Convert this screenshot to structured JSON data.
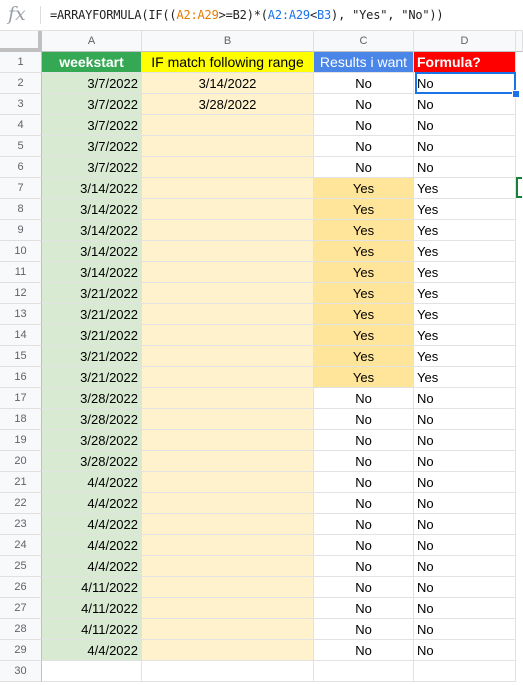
{
  "formula_bar": {
    "icon": "fx-icon",
    "parts": [
      {
        "text": "=ARRAYFORMULA(IF((",
        "color": ""
      },
      {
        "text": "A2:A29",
        "color": "#e67c00"
      },
      {
        "text": ">=B2)*(",
        "color": ""
      },
      {
        "text": "A2:A29",
        "color": "#1a73e8"
      },
      {
        "text": "<",
        "color": ""
      },
      {
        "text": "B3",
        "color": "#1a73e8"
      },
      {
        "text": "), \"Yes\", \"No\"))",
        "color": ""
      }
    ]
  },
  "columns": [
    "A",
    "B",
    "C",
    "D"
  ],
  "headers": {
    "A": "weekstart",
    "B": "IF match following range",
    "C": "Results i want",
    "D": "Formula?"
  },
  "colors": {
    "header_A_bg": "#34a853",
    "header_B_bg": "#ffff00",
    "header_C_bg": "#4a86e8",
    "header_D_bg": "#ff0000",
    "col_A_bg": "#d9ead3",
    "col_B_bg": "#fff2cc",
    "col_C_highlight_bg": "#ffe599",
    "selection": "#1a73e8"
  },
  "rows": [
    {
      "num": "2",
      "a": "3/7/2022",
      "b": "3/14/2022",
      "c": "No",
      "d": "No"
    },
    {
      "num": "3",
      "a": "3/7/2022",
      "b": "3/28/2022",
      "c": "No",
      "d": "No"
    },
    {
      "num": "4",
      "a": "3/7/2022",
      "b": "",
      "c": "No",
      "d": "No"
    },
    {
      "num": "5",
      "a": "3/7/2022",
      "b": "",
      "c": "No",
      "d": "No"
    },
    {
      "num": "6",
      "a": "3/7/2022",
      "b": "",
      "c": "No",
      "d": "No"
    },
    {
      "num": "7",
      "a": "3/14/2022",
      "b": "",
      "c": "Yes",
      "d": "Yes"
    },
    {
      "num": "8",
      "a": "3/14/2022",
      "b": "",
      "c": "Yes",
      "d": "Yes"
    },
    {
      "num": "9",
      "a": "3/14/2022",
      "b": "",
      "c": "Yes",
      "d": "Yes"
    },
    {
      "num": "10",
      "a": "3/14/2022",
      "b": "",
      "c": "Yes",
      "d": "Yes"
    },
    {
      "num": "11",
      "a": "3/14/2022",
      "b": "",
      "c": "Yes",
      "d": "Yes"
    },
    {
      "num": "12",
      "a": "3/21/2022",
      "b": "",
      "c": "Yes",
      "d": "Yes"
    },
    {
      "num": "13",
      "a": "3/21/2022",
      "b": "",
      "c": "Yes",
      "d": "Yes"
    },
    {
      "num": "14",
      "a": "3/21/2022",
      "b": "",
      "c": "Yes",
      "d": "Yes"
    },
    {
      "num": "15",
      "a": "3/21/2022",
      "b": "",
      "c": "Yes",
      "d": "Yes"
    },
    {
      "num": "16",
      "a": "3/21/2022",
      "b": "",
      "c": "Yes",
      "d": "Yes"
    },
    {
      "num": "17",
      "a": "3/28/2022",
      "b": "",
      "c": "No",
      "d": "No"
    },
    {
      "num": "18",
      "a": "3/28/2022",
      "b": "",
      "c": "No",
      "d": "No"
    },
    {
      "num": "19",
      "a": "3/28/2022",
      "b": "",
      "c": "No",
      "d": "No"
    },
    {
      "num": "20",
      "a": "3/28/2022",
      "b": "",
      "c": "No",
      "d": "No"
    },
    {
      "num": "21",
      "a": "4/4/2022",
      "b": "",
      "c": "No",
      "d": "No"
    },
    {
      "num": "22",
      "a": "4/4/2022",
      "b": "",
      "c": "No",
      "d": "No"
    },
    {
      "num": "23",
      "a": "4/4/2022",
      "b": "",
      "c": "No",
      "d": "No"
    },
    {
      "num": "24",
      "a": "4/4/2022",
      "b": "",
      "c": "No",
      "d": "No"
    },
    {
      "num": "25",
      "a": "4/4/2022",
      "b": "",
      "c": "No",
      "d": "No"
    },
    {
      "num": "26",
      "a": "4/11/2022",
      "b": "",
      "c": "No",
      "d": "No"
    },
    {
      "num": "27",
      "a": "4/11/2022",
      "b": "",
      "c": "No",
      "d": "No"
    },
    {
      "num": "28",
      "a": "4/11/2022",
      "b": "",
      "c": "No",
      "d": "No"
    },
    {
      "num": "29",
      "a": "4/4/2022",
      "b": "",
      "c": "No",
      "d": "No"
    }
  ],
  "header_row_num": "1",
  "last_row_num": "30"
}
